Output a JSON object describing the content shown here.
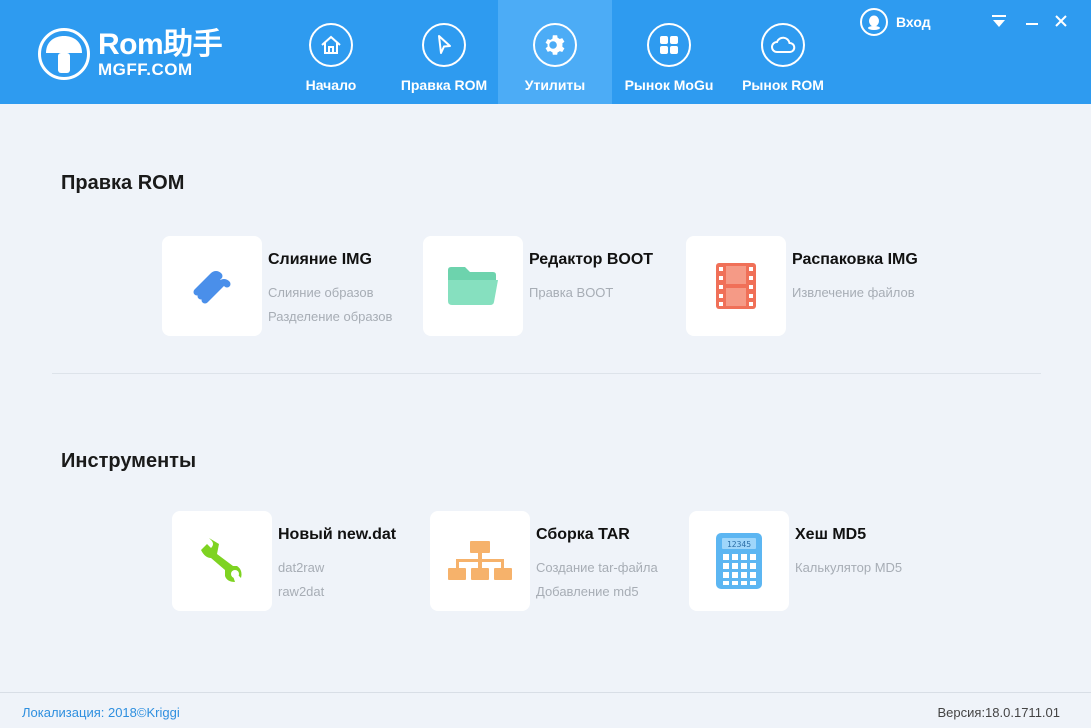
{
  "header": {
    "logo": {
      "main": "Rom助手",
      "sub": "MGFF.COM"
    },
    "tabs": [
      {
        "label": "Начало",
        "icon": "home-icon"
      },
      {
        "label": "Правка ROM",
        "icon": "cursor-icon"
      },
      {
        "label": "Утилиты",
        "icon": "gear-icon",
        "active": true
      },
      {
        "label": "Рынок MoGu",
        "icon": "grid-icon"
      },
      {
        "label": "Рынок ROM",
        "icon": "cloud-icon"
      }
    ],
    "login_label": "Вход"
  },
  "sections": [
    {
      "title": "Правка ROM",
      "cards": [
        {
          "title": "Слияние IMG",
          "lines": [
            "Слияние образов",
            "Разделение образов"
          ],
          "icon": "link-icon"
        },
        {
          "title": "Редактор BOOT",
          "lines": [
            "Правка BOOT"
          ],
          "icon": "folder-icon"
        },
        {
          "title": "Распаковка IMG",
          "lines": [
            "Извлечение файлов"
          ],
          "icon": "film-icon"
        }
      ]
    },
    {
      "title": "Инструменты",
      "cards": [
        {
          "title": "Новый new.dat",
          "lines": [
            "dat2raw",
            "raw2dat"
          ],
          "icon": "wrench-icon"
        },
        {
          "title": "Сборка TAR",
          "lines": [
            "Создание tar-файла",
            "Добавление md5"
          ],
          "icon": "hierarchy-icon"
        },
        {
          "title": "Хеш MD5",
          "lines": [
            "Калькулятор MD5"
          ],
          "icon": "calculator-icon",
          "display_text": "12345"
        }
      ]
    }
  ],
  "footer": {
    "left": "Локализация: 2018©Kriggi",
    "right": "Версия:18.0.1711.01"
  },
  "colors": {
    "header_bg": "#2e9bf0",
    "active_tab": "#4cacf6",
    "body_bg": "#eff3f9",
    "link_icon": "#4a8fea",
    "folder_icon": "#6dd3ad",
    "film_icon": "#f07058",
    "wrench_icon": "#7ed321",
    "hierarchy_icon": "#f6b26b",
    "calculator_icon": "#5cb6f2"
  }
}
